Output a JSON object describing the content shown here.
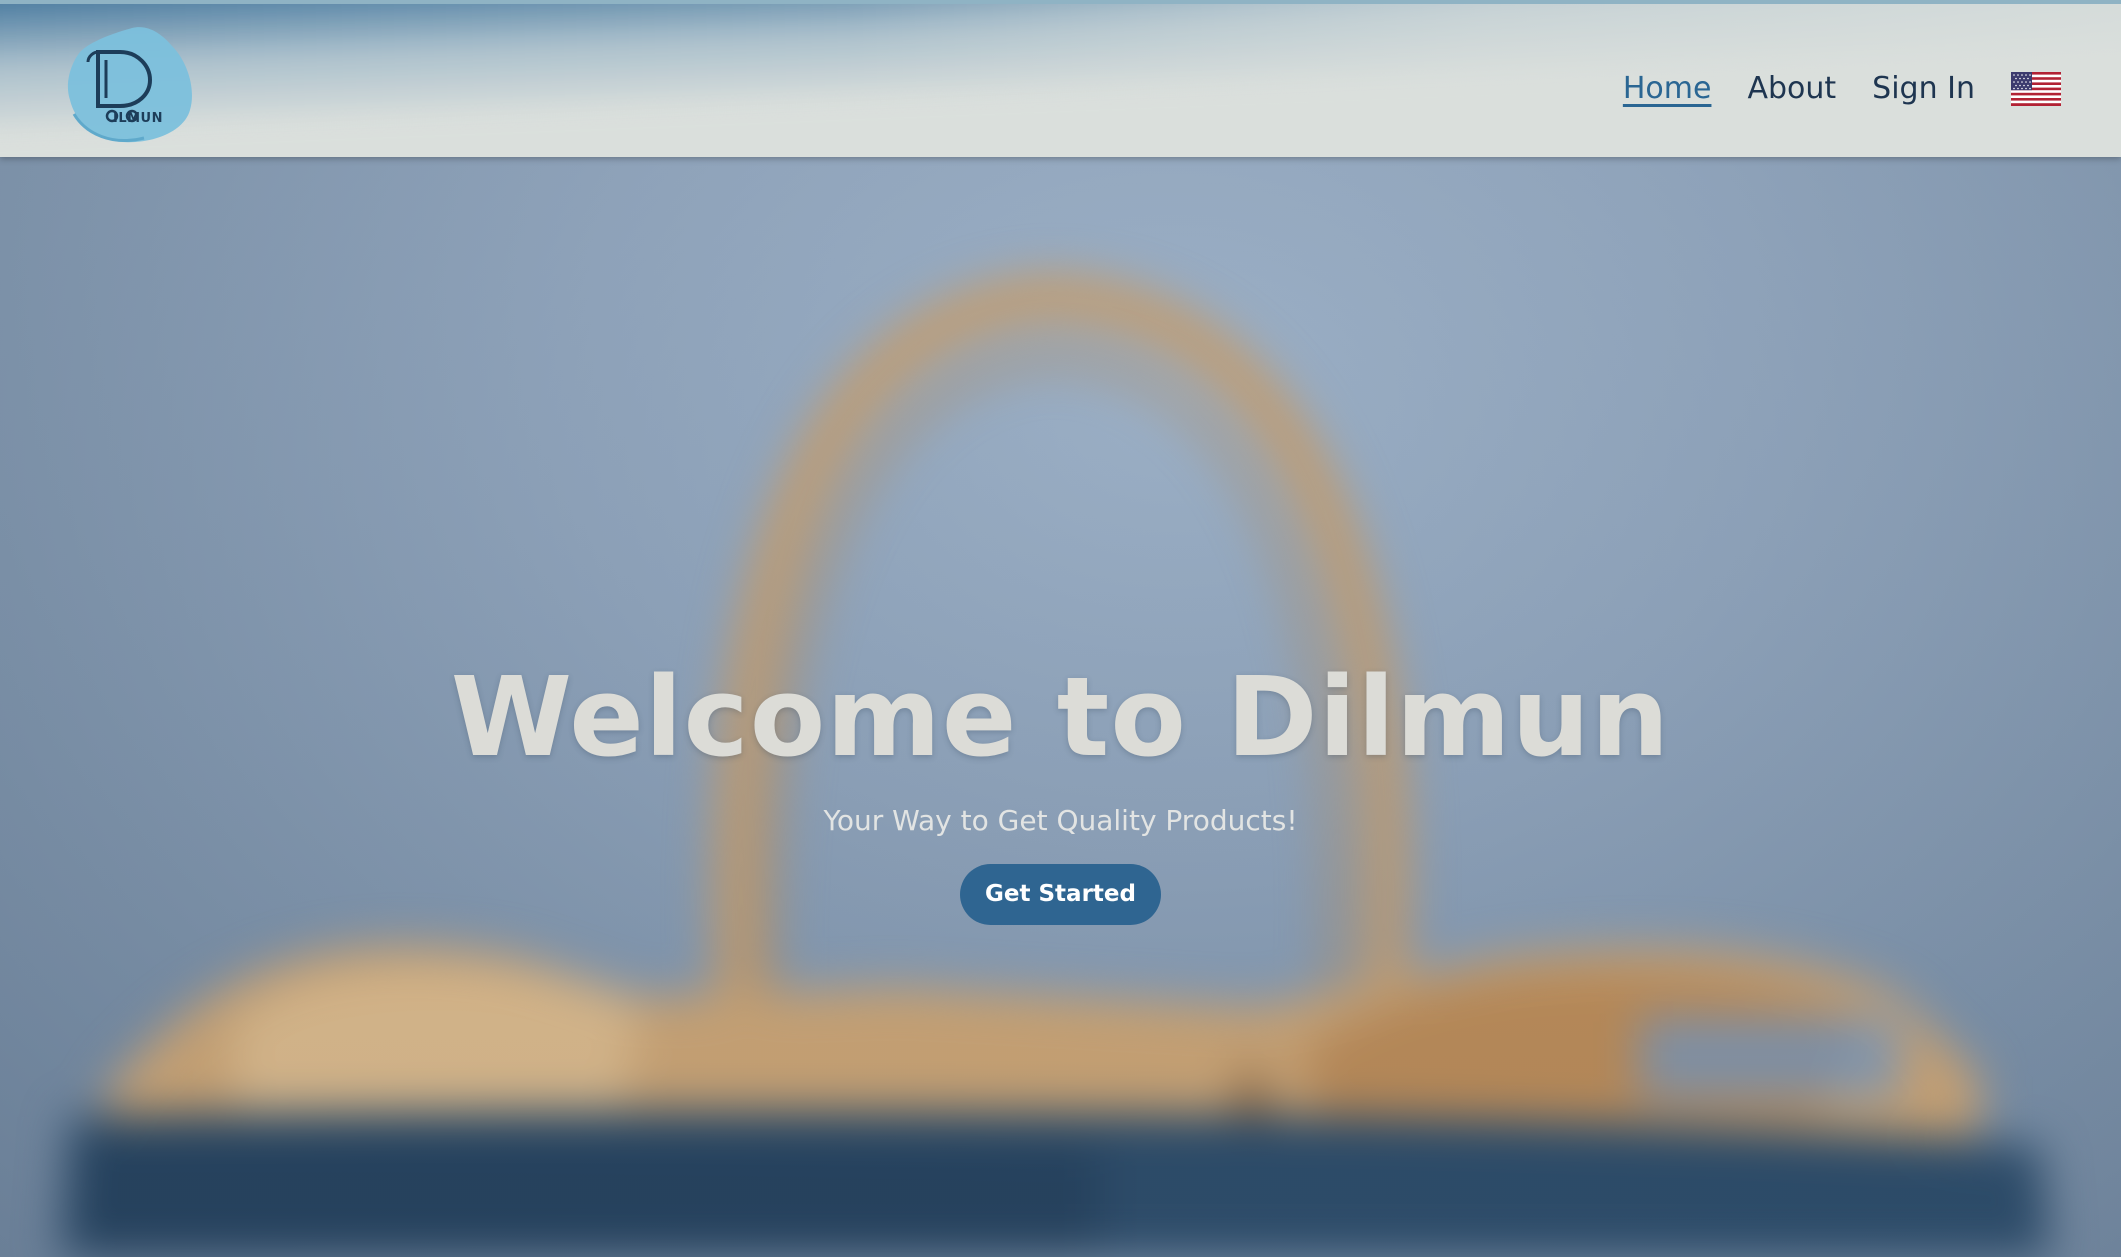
{
  "header": {
    "logo_text": "ILMUN",
    "nav": {
      "home": "Home",
      "about": "About",
      "sign_in": "Sign In"
    },
    "language_icon": "us-flag-icon"
  },
  "hero": {
    "title": "Welcome to Dilmun",
    "subtitle": "Your Way to Get Quality Products!",
    "cta_label": "Get Started"
  },
  "colors": {
    "header_bg": "#dadfdc",
    "nav_text": "#1e3550",
    "nav_active": "#2a6693",
    "cta_bg": "#2f6591",
    "hero_title": "#dcdcd7"
  }
}
